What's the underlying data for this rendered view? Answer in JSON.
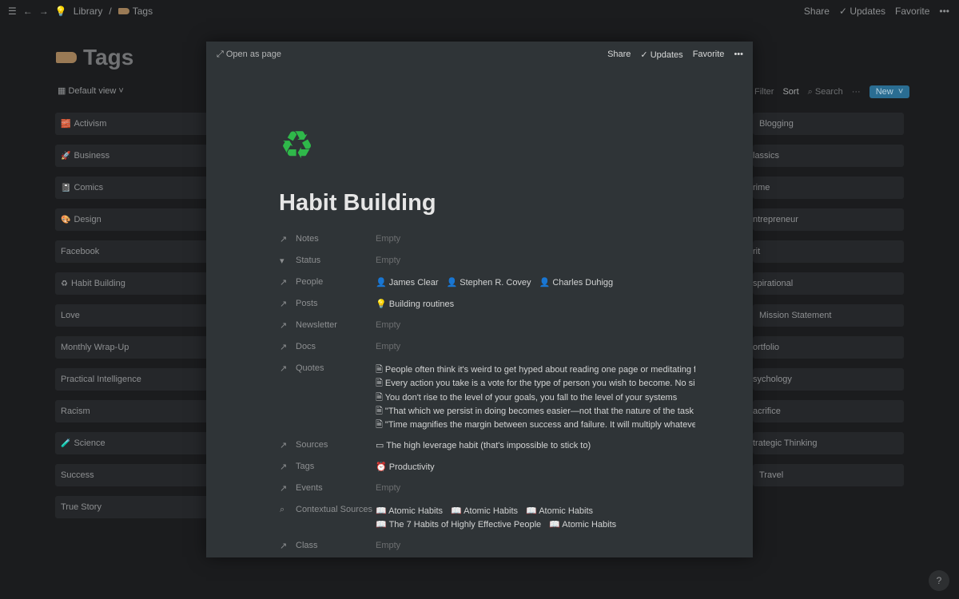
{
  "topbar": {
    "breadcrumb": [
      "Library",
      "Tags"
    ],
    "share": "Share",
    "updates": "Updates",
    "favorite": "Favorite",
    "more": "•••"
  },
  "page": {
    "title": "Tags",
    "view": "Default view"
  },
  "toolbar": {
    "filter": "Filter",
    "sort": "Sort",
    "search": "Search",
    "more": "···",
    "new": "New"
  },
  "left_cards": [
    "Activism",
    "Business",
    "Comics",
    "Design",
    "Facebook",
    "Habit Building",
    "Love",
    "Monthly Wrap-Up",
    "Practical Intelligence",
    "Racism",
    "Science",
    "Success",
    "True Story"
  ],
  "right_cards": [
    "Blogging",
    "lassics",
    "rime",
    "ntrepreneur",
    "rit",
    "spirational",
    "Mission Statement",
    "ortfolio",
    "sychology",
    "acrifice",
    "trategic Thinking",
    "Travel"
  ],
  "modal": {
    "open_as_page": "Open as page",
    "share": "Share",
    "updates": "Updates",
    "favorite": "Favorite",
    "more": "•••",
    "icon": "recycle-icon",
    "title": "Habit Building",
    "props": {
      "notes": {
        "label": "Notes",
        "value": "Empty"
      },
      "status": {
        "label": "Status",
        "value": "Empty"
      },
      "people": {
        "label": "People",
        "values": [
          "James Clear",
          "Stephen R. Covey",
          "Charles Duhigg"
        ]
      },
      "posts": {
        "label": "Posts",
        "values": [
          "Building routines"
        ]
      },
      "newsletter": {
        "label": "Newsletter",
        "value": "Empty"
      },
      "docs": {
        "label": "Docs",
        "value": "Empty"
      },
      "quotes": {
        "label": "Quotes",
        "values": [
          "People often think it's weird to get hyped about reading one page or meditating for c",
          "Every action you take is a vote for the type of person you wish to become. No single",
          "You don't rise to the level of your goals, you fall to the level of your systems",
          "\"That which we persist in doing becomes easier—not that the nature of the task has",
          "\"Time magnifies the margin between success and failure. It will multiply whatever yo"
        ]
      },
      "sources": {
        "label": "Sources",
        "values": [
          "The high leverage habit (that's impossible to stick to)"
        ]
      },
      "tags": {
        "label": "Tags",
        "values": [
          "Productivity"
        ]
      },
      "events": {
        "label": "Events",
        "value": "Empty"
      },
      "contextual": {
        "label": "Contextual Sources",
        "values": [
          "Atomic Habits",
          "Atomic Habits",
          "Atomic Habits",
          "The 7 Habits of Highly Effective People",
          "Atomic Habits"
        ]
      },
      "class": {
        "label": "Class",
        "value": "Empty"
      }
    }
  },
  "help": "?"
}
